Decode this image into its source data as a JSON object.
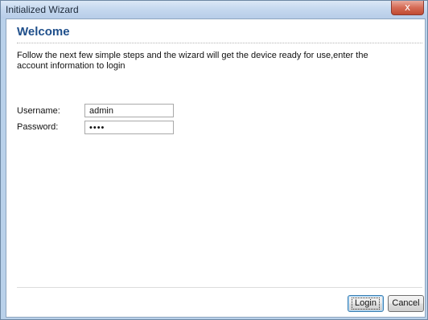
{
  "window": {
    "title": "Initialized Wizard",
    "close_label": "x"
  },
  "wizard": {
    "heading": "Welcome",
    "description": "Follow the next few simple steps and the wizard will get the device ready for use,enter the account information to login"
  },
  "form": {
    "username_label": "Username:",
    "username_value": "admin",
    "password_label": "Password:",
    "password_value": "****"
  },
  "buttons": {
    "login_label": "Login",
    "cancel_label": "Cancel"
  },
  "colors": {
    "heading": "#1f4f8b",
    "titlebar": "#c6d9ef",
    "close_button": "#c04a32"
  }
}
